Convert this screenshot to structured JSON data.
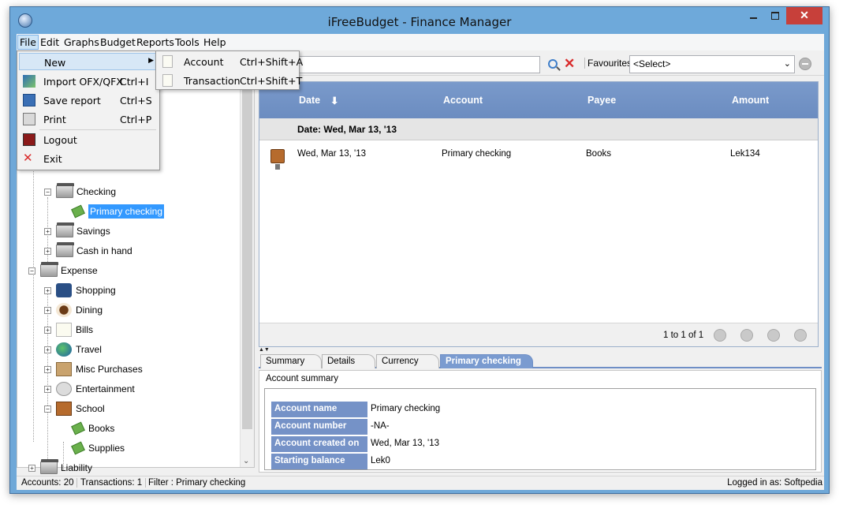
{
  "window": {
    "title": "iFreeBudget - Finance Manager",
    "close_glyph": "✕"
  },
  "menubar": [
    "File",
    "Edit",
    "Graphs",
    "Budget",
    "Reports",
    "Tools",
    "Help"
  ],
  "file_menu": {
    "new_label": "New",
    "items": [
      {
        "label": "Import OFX/QFX",
        "shortcut": "Ctrl+I",
        "icon": "import-icon"
      },
      {
        "label": "Save report",
        "shortcut": "Ctrl+S",
        "icon": "save-icon"
      },
      {
        "label": "Print",
        "shortcut": "Ctrl+P",
        "icon": "print-icon"
      },
      {
        "label": "Logout",
        "shortcut": "",
        "icon": "logout-icon"
      },
      {
        "label": "Exit",
        "shortcut": "",
        "icon": "exit-icon"
      }
    ]
  },
  "new_submenu": [
    {
      "label": "Account",
      "shortcut": "Ctrl+Shift+A"
    },
    {
      "label": "Transaction",
      "shortcut": "Ctrl+Shift+T"
    }
  ],
  "toolbar": {
    "search_value": "",
    "favourites_label": "Favourites",
    "favourites_selected": "<Select>"
  },
  "tree": {
    "checking": "Checking",
    "primary_checking": "Primary checking",
    "savings": "Savings",
    "cash_in_hand": "Cash in hand",
    "expense": "Expense",
    "shopping": "Shopping",
    "dining": "Dining",
    "bills": "Bills",
    "travel": "Travel",
    "misc": "Misc Purchases",
    "entertainment": "Entertainment",
    "school": "School",
    "books": "Books",
    "supplies": "Supplies",
    "liability": "Liability"
  },
  "grid": {
    "columns": [
      "Date",
      "Account",
      "Payee",
      "Amount"
    ],
    "sort_glyph": "⬇",
    "group_header": "Date: Wed, Mar 13, '13",
    "rows": [
      {
        "date": "Wed, Mar 13, '13",
        "account": "Primary checking",
        "payee": "Books",
        "amount": "Lek134"
      }
    ],
    "pager_text": "1 to 1 of 1"
  },
  "tabs": [
    "Summary",
    "Details",
    "Currency",
    "Primary checking"
  ],
  "details": {
    "section_title": "Account summary",
    "rows": [
      {
        "key": "Account name",
        "value": "Primary checking"
      },
      {
        "key": "Account number",
        "value": "-NA-"
      },
      {
        "key": "Account created on",
        "value": "Wed, Mar 13, '13"
      },
      {
        "key": "Starting balance",
        "value": "Lek0"
      }
    ]
  },
  "status": {
    "accounts": "Accounts: 20",
    "transactions": "Transactions: 1",
    "filter": "Filter : Primary checking",
    "logged_in": "Logged in as: Softpedia"
  },
  "colors": {
    "titlebar": "#6ea9da",
    "grid_header": "#7a9acb",
    "selection": "#3399ff",
    "close": "#c7403a"
  }
}
